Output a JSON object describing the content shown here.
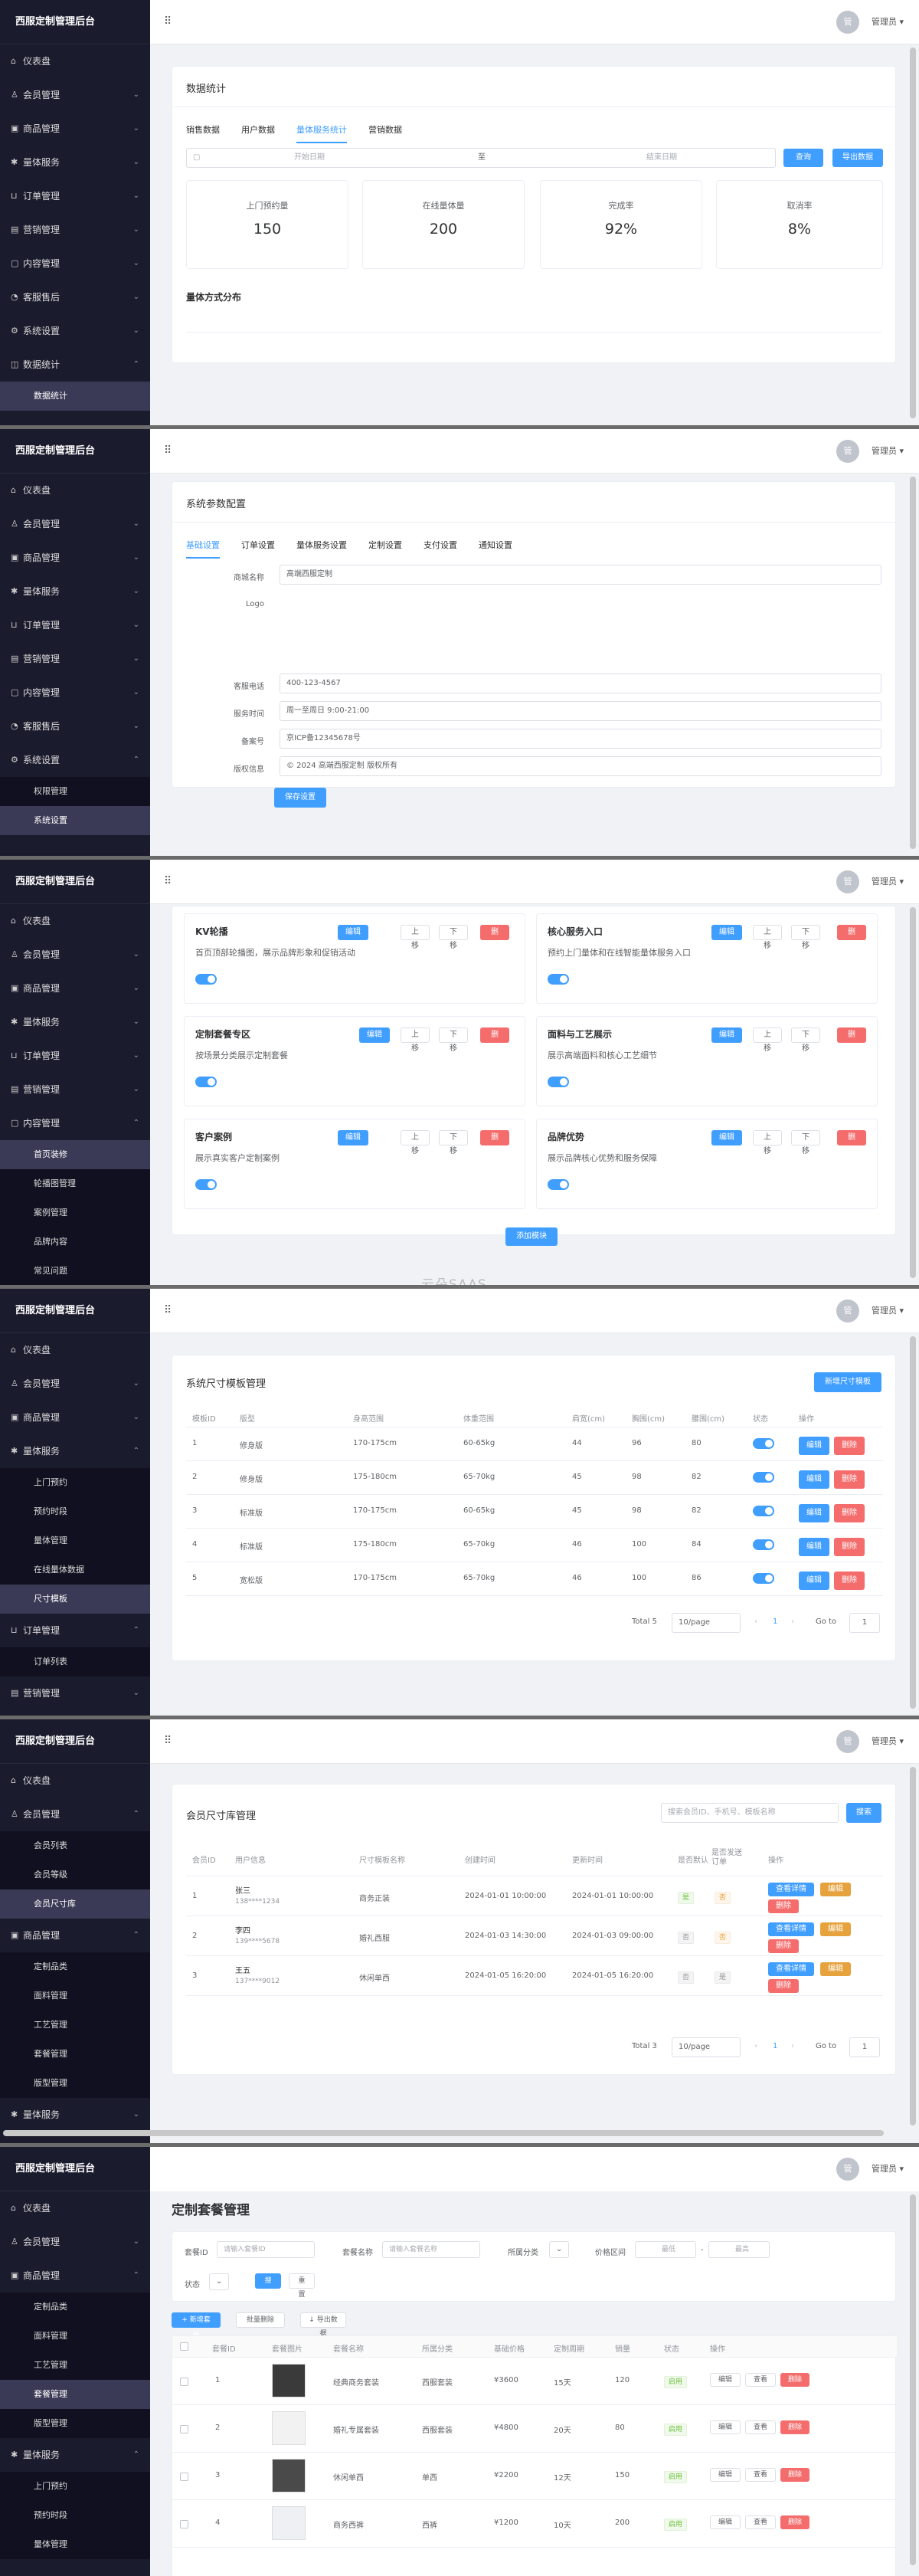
{
  "app": {
    "brand": "西服定制管理后台",
    "user_avatar": "管",
    "user_name": "管理员 ▾",
    "fold_icon": "⠿"
  },
  "menu": {
    "dashboard": "仪表盘",
    "member": "会员管理",
    "goods": "商品管理",
    "body": "量体服务",
    "order": "订单管理",
    "marketing": "营销管理",
    "content": "内容管理",
    "service": "客服售后",
    "system": "系统设置",
    "data": "数据统计"
  },
  "sub": {
    "data_stats": "数据统计",
    "perm": "权限管理",
    "sys_settings": "系统设置",
    "home_kv": "首页装修",
    "carousel": "轮播图管理",
    "case": "案例管理",
    "brand_content": "品牌内容",
    "faq": "常见问题",
    "appointment": "上门预约",
    "booking_time": "预约时段",
    "body_mgmt": "量体管理",
    "online_data": "在线量体数据",
    "size_tpl": "尺寸模板",
    "order_list": "订单列表",
    "member_list": "会员列表",
    "member_level": "会员等级",
    "member_size": "会员尺寸库",
    "custom_goods": "定制品类",
    "fabric": "面料管理",
    "craft": "工艺管理",
    "package": "套餐管理",
    "style": "版型管理"
  },
  "p1": {
    "title": "数据统计",
    "tabs": [
      "销售数据",
      "用户数据",
      "量体服务统计",
      "营销数据"
    ],
    "start_ph": "开始日期",
    "to": "至",
    "end_ph": "结束日期",
    "query": "查询",
    "export": "导出数据",
    "stats": [
      {
        "label": "上门预约量",
        "value": "150"
      },
      {
        "label": "在线量体量",
        "value": "200"
      },
      {
        "label": "完成率",
        "value": "92%"
      },
      {
        "label": "取消率",
        "value": "8%"
      }
    ],
    "section": "量体方式分布"
  },
  "p2": {
    "title": "系统参数配置",
    "tabs": [
      "基础设置",
      "订单设置",
      "量体服务设置",
      "定制设置",
      "支付设置",
      "通知设置"
    ],
    "fields": [
      {
        "label": "商城名称",
        "value": "高端西服定制"
      },
      {
        "label": "Logo",
        "value": ""
      },
      {
        "label": "客服电话",
        "value": "400-123-4567"
      },
      {
        "label": "服务时间",
        "value": "周一至周日 9:00-21:00"
      },
      {
        "label": "备案号",
        "value": "京ICP备12345678号"
      },
      {
        "label": "版权信息",
        "value": "© 2024 高端西服定制 版权所有"
      }
    ],
    "save": "保存设置"
  },
  "p3": {
    "modules": [
      {
        "title": "KV轮播",
        "desc": "首页顶部轮播图，展示品牌形象和促销活动"
      },
      {
        "title": "核心服务入口",
        "desc": "预约上门量体和在线智能量体服务入口"
      },
      {
        "title": "定制套餐专区",
        "desc": "按场景分类展示定制套餐"
      },
      {
        "title": "面料与工艺展示",
        "desc": "展示高端面料和核心工艺细节"
      },
      {
        "title": "客户案例",
        "desc": "展示真实客户定制案例"
      },
      {
        "title": "品牌优势",
        "desc": "展示品牌核心优势和服务保障"
      }
    ],
    "edit": "编辑",
    "up": "上移",
    "down": "下移",
    "del": "删除",
    "add": "添加模块",
    "watermark": "云朵SAAS"
  },
  "p4": {
    "title": "系统尺寸模板管理",
    "add": "新增尺寸模板",
    "headers": [
      "模板ID",
      "版型",
      "身高范围",
      "体重范围",
      "肩宽(cm)",
      "胸围(cm)",
      "腰围(cm)",
      "状态",
      "操作"
    ],
    "rows": [
      [
        "1",
        "修身版",
        "170-175cm",
        "60-65kg",
        "44",
        "96",
        "80"
      ],
      [
        "2",
        "修身版",
        "175-180cm",
        "65-70kg",
        "45",
        "98",
        "82"
      ],
      [
        "3",
        "标准版",
        "170-175cm",
        "60-65kg",
        "45",
        "98",
        "82"
      ],
      [
        "4",
        "标准版",
        "175-180cm",
        "65-70kg",
        "46",
        "100",
        "84"
      ],
      [
        "5",
        "宽松版",
        "170-175cm",
        "65-70kg",
        "46",
        "100",
        "86"
      ]
    ],
    "edit": "编辑",
    "del": "删除",
    "total": "Total 5",
    "size": "10/page",
    "page": "1",
    "goto": "Go to",
    "goto_val": "1"
  },
  "p5": {
    "title": "会员尺寸库管理",
    "search_ph": "搜索会员ID、手机号、模板名称",
    "search": "搜索",
    "headers": [
      "会员ID",
      "用户信息",
      "尺寸模板名称",
      "创建时间",
      "更新时间",
      "是否默认",
      "是否发送订单",
      "操作"
    ],
    "rows": [
      {
        "id": "1",
        "name": "张三",
        "phone": "138****1234",
        "tpl": "商务正装",
        "created": "2024-01-01 10:00:00",
        "updated": "2024-01-01 10:00:00",
        "def": "是",
        "sent": "否"
      },
      {
        "id": "2",
        "name": "李四",
        "phone": "139****5678",
        "tpl": "婚礼西服",
        "created": "2024-01-03 14:30:00",
        "updated": "2024-01-03 09:00:00",
        "def": "否",
        "sent": "否"
      },
      {
        "id": "3",
        "name": "王五",
        "phone": "137****9012",
        "tpl": "休闲单西",
        "created": "2024-01-05 16:20:00",
        "updated": "2024-01-05 16:20:00",
        "def": "否",
        "sent": "是"
      }
    ],
    "detail": "查看详情",
    "edit": "编辑",
    "del": "删除",
    "total": "Total 3",
    "size": "10/page",
    "page": "1",
    "goto": "Go to",
    "goto_val": "1"
  },
  "p6": {
    "title": "定制套餐管理",
    "f_id": "套餐ID",
    "f_id_ph": "请输入套餐ID",
    "f_name": "套餐名称",
    "f_name_ph": "请输入套餐名称",
    "f_cat": "所属分类",
    "f_price": "价格区间",
    "f_min": "最低",
    "f_max": "最高",
    "f_status": "状态",
    "search": "搜索",
    "reset": "重置",
    "add": "+ 新增套餐",
    "batch_del": "批量删除",
    "export": "↓ 导出数据",
    "headers": [
      "套餐ID",
      "套餐图片",
      "套餐名称",
      "所属分类",
      "基础价格",
      "定制周期",
      "销量",
      "状态",
      "操作"
    ],
    "rows": [
      [
        "1",
        "经典商务套装",
        "西服套装",
        "¥3600",
        "15天",
        "120"
      ],
      [
        "2",
        "婚礼专属套装",
        "西服套装",
        "¥4800",
        "20天",
        "80"
      ],
      [
        "3",
        "休闲单西",
        "单西",
        "¥2200",
        "12天",
        "150"
      ],
      [
        "4",
        "商务西裤",
        "西裤",
        "¥1200",
        "10天",
        "200"
      ]
    ],
    "on": "启用",
    "edit": "编辑",
    "view": "查看",
    "del": "删除"
  }
}
